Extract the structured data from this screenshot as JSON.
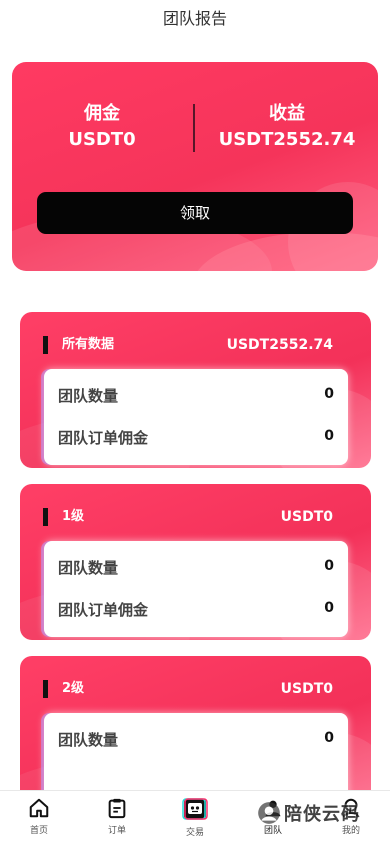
{
  "header": {
    "title": "团队报告"
  },
  "summary": {
    "commission_label": "佣金",
    "commission_value": "USDT0",
    "income_label": "收益",
    "income_value": "USDT2552.74",
    "claim_button": "领取"
  },
  "levels": [
    {
      "title": "所有数据",
      "amount": "USDT2552.74",
      "rows": [
        {
          "label": "团队数量",
          "value": "0"
        },
        {
          "label": "团队订单佣金",
          "value": "0"
        }
      ]
    },
    {
      "title": "1级",
      "amount": "USDT0",
      "rows": [
        {
          "label": "团队数量",
          "value": "0"
        },
        {
          "label": "团队订单佣金",
          "value": "0"
        }
      ]
    },
    {
      "title": "2级",
      "amount": "USDT0",
      "rows": [
        {
          "label": "团队数量",
          "value": "0"
        }
      ]
    }
  ],
  "tabbar": {
    "items": [
      {
        "label": "首页",
        "icon": "home-icon"
      },
      {
        "label": "订单",
        "icon": "clipboard-icon"
      },
      {
        "label": "交易",
        "icon": "robot-icon"
      },
      {
        "label": "团队",
        "icon": "team-icon"
      },
      {
        "label": "我的",
        "icon": "user-icon"
      }
    ],
    "active_index": 3
  },
  "watermark": {
    "text": "陪侠云码"
  },
  "colors": {
    "accent": "#f5345a",
    "button": "#050505"
  }
}
